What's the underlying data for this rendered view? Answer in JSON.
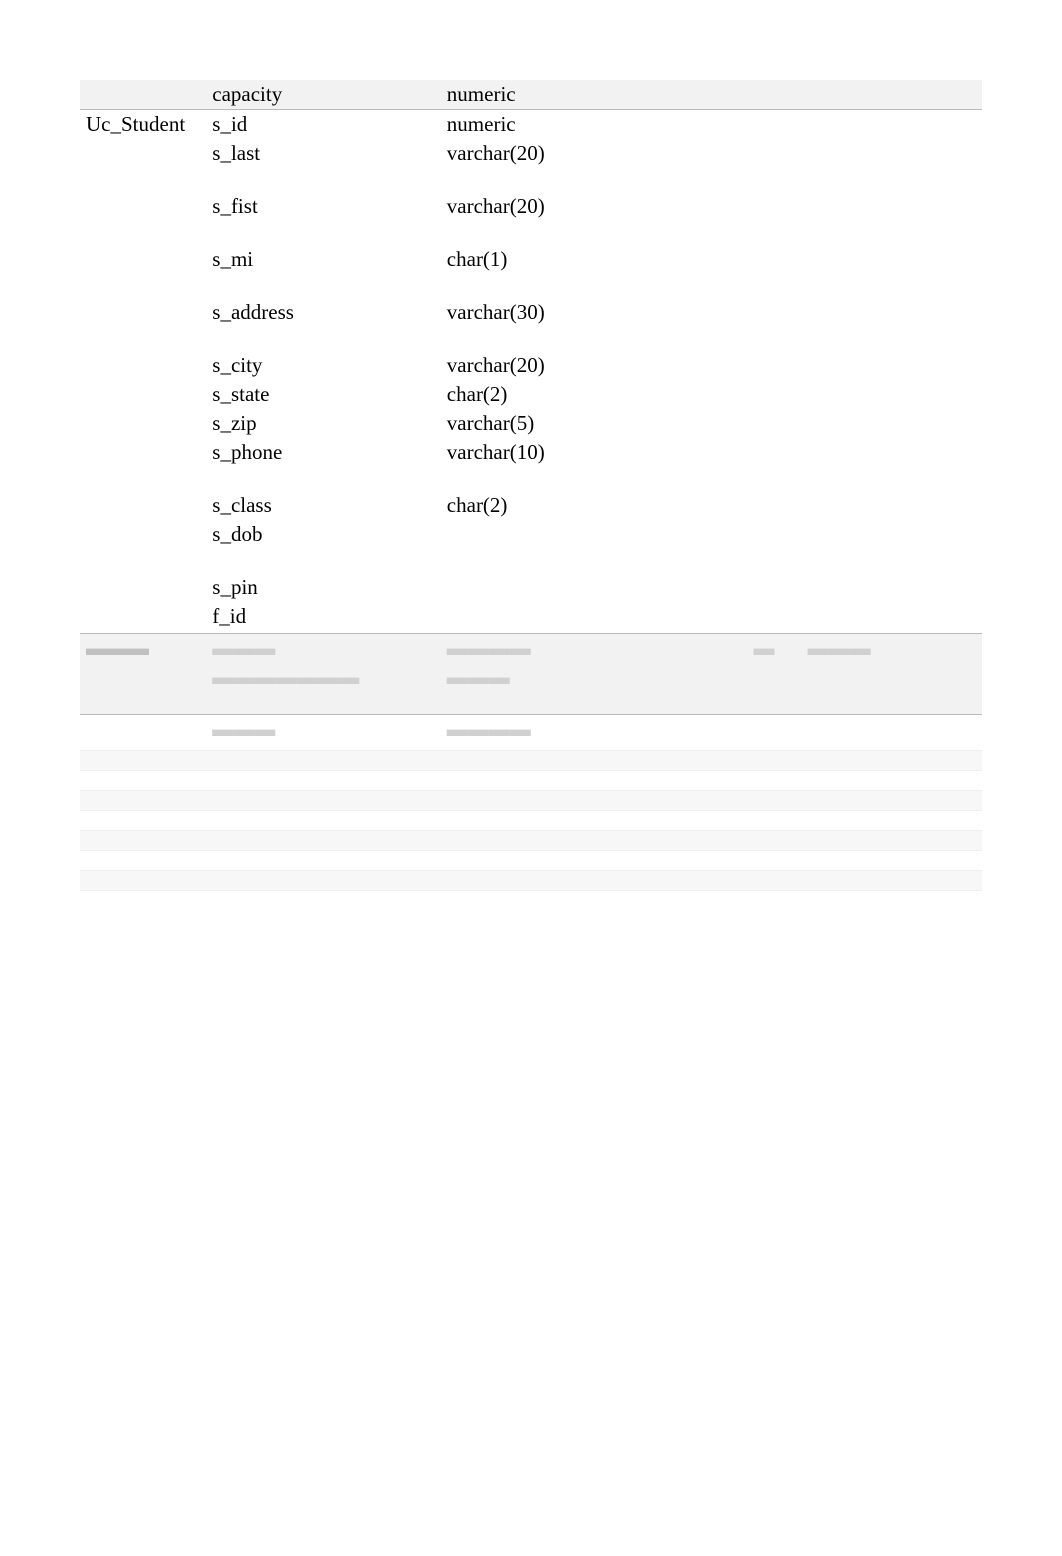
{
  "schema": {
    "rows": [
      {
        "table": "",
        "field": "capacity",
        "type": "numeric",
        "a": "",
        "b": "",
        "c": "",
        "d": "",
        "shade": true,
        "sep": false,
        "tall": false
      },
      {
        "table": "Uc_Student",
        "field": "s_id",
        "type": "numeric",
        "a": "",
        "b": "",
        "c": "",
        "d": "",
        "shade": false,
        "sep": true,
        "tall": false
      },
      {
        "table": "",
        "field": "s_last",
        "type": "varchar(20)",
        "a": "",
        "b": "",
        "c": "",
        "d": "",
        "shade": false,
        "sep": false,
        "tall": true
      },
      {
        "table": "",
        "field": "s_fist",
        "type": "varchar(20)",
        "a": "",
        "b": "",
        "c": "",
        "d": "",
        "shade": false,
        "sep": false,
        "tall": true
      },
      {
        "table": "",
        "field": "s_mi",
        "type": "char(1)",
        "a": "",
        "b": "",
        "c": "",
        "d": "",
        "shade": false,
        "sep": false,
        "tall": true
      },
      {
        "table": "",
        "field": "s_address",
        "type": "varchar(30)",
        "a": "",
        "b": "",
        "c": "",
        "d": "",
        "shade": false,
        "sep": false,
        "tall": true
      },
      {
        "table": "",
        "field": "s_city",
        "type": "varchar(20)",
        "a": "",
        "b": "",
        "c": "",
        "d": "",
        "shade": false,
        "sep": false,
        "tall": false
      },
      {
        "table": "",
        "field": "s_state",
        "type": "char(2)",
        "a": "",
        "b": "",
        "c": "",
        "d": "",
        "shade": false,
        "sep": false,
        "tall": false
      },
      {
        "table": "",
        "field": "s_zip",
        "type": "varchar(5)",
        "a": "",
        "b": "",
        "c": "",
        "d": "",
        "shade": false,
        "sep": false,
        "tall": false
      },
      {
        "table": "",
        "field": "s_phone",
        "type": "varchar(10)",
        "a": "",
        "b": "",
        "c": "",
        "d": "",
        "shade": false,
        "sep": false,
        "tall": true
      },
      {
        "table": "",
        "field": "s_class",
        "type": "char(2)",
        "a": "",
        "b": "",
        "c": "",
        "d": "",
        "shade": false,
        "sep": false,
        "tall": false
      },
      {
        "table": "",
        "field": "s_dob",
        "type": "",
        "a": "",
        "b": "",
        "c": "",
        "d": "",
        "shade": false,
        "sep": false,
        "tall": true
      },
      {
        "table": "",
        "field": "s_pin",
        "type": "",
        "a": "",
        "b": "",
        "c": "",
        "d": "",
        "shade": false,
        "sep": false,
        "tall": false
      },
      {
        "table": "",
        "field": "f_id",
        "type": "",
        "a": "",
        "b": "",
        "c": "",
        "d": "",
        "shade": false,
        "sep": false,
        "tall": false
      }
    ]
  }
}
